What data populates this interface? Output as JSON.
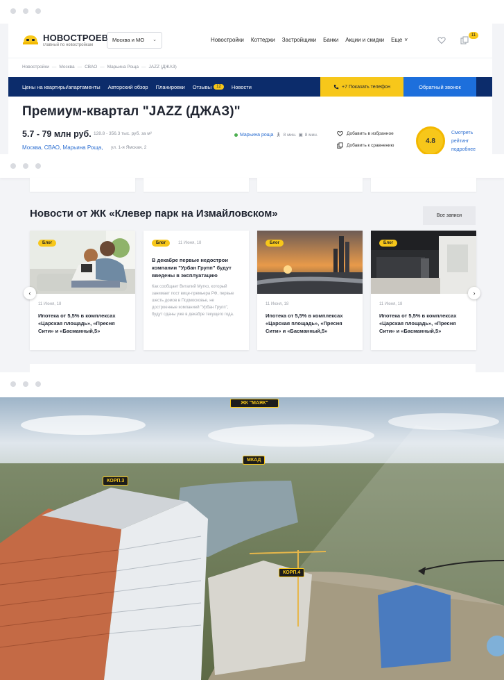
{
  "header": {
    "logo_name": "НОВОСТРОЕВ",
    "logo_tagline": "главный по новостройкам",
    "city": "Москва и МО",
    "nav": [
      "Новостройки",
      "Коттеджи",
      "Застройщики",
      "Банки",
      "Акции и скидки"
    ],
    "nav_more": "Еще",
    "compare_count": "11"
  },
  "breadcrumbs": [
    "Новостройки",
    "Москва",
    "СВАО",
    "Марьина Роща",
    "JAZZ (ДЖАЗ)"
  ],
  "menu": {
    "items": [
      "Цены на квартиры/апартаменты",
      "Авторский обзор",
      "Планировки"
    ],
    "reviews_label": "Отзывы",
    "reviews_count": "12",
    "news_label": "Новости",
    "phone_button": "+7 Показать телефон",
    "callback_button": "Обратный звонок"
  },
  "listing": {
    "title": "Премиум-квартал \"JAZZ (ДЖАЗ)\"",
    "price": "5.7 - 79 млн руб.",
    "price_sqm": "128.8 - 356.3 тыс. руб. за м²",
    "location": "Москва, СВАО, Марьина Роща,",
    "address": "ул. 1-я Ямская, 2",
    "metro": "Марьина роща",
    "metro_walk": "8 мин.",
    "metro_transport": "8 мин.",
    "favorite_label": "Добавить в избранное",
    "compare_label": "Добавить к сравнению",
    "rating": "4.8",
    "rating_link": "Смотреть рейтинг подробнее"
  },
  "news": {
    "title": "Новости от ЖК «Клевер парк на Измайловском»",
    "all_button": "Все записи",
    "badge": "Блог",
    "cards": [
      {
        "date": "11 Июня, 18",
        "headline": "Ипотека от 5,5% в комплексах «Царская площадь», «Пресня Сити» и «Басманный,5»"
      },
      {
        "date": "11 Июня, 18",
        "headline": "В декабре первые недострои компании \"Урбан Групп\" будут введены в эксплуатацию",
        "excerpt": "Как сообщает Виталий Мутко, который занимает пост вице-премьера РФ, первые шесть домов в Подмосковье, не достроенные компанией \"Урбан Групп\", будут сданы уже в декабре текущего года."
      },
      {
        "date": "11 Июня, 18",
        "headline": "Ипотека от 5,5% в комплексах «Царская площадь», «Пресня Сити» и «Басманный,5»"
      },
      {
        "date": "11 Июня, 18",
        "headline": "Ипотека от 5,5% в комплексах «Царская площадь», «Пресня Сити» и «Басманный,5»"
      }
    ]
  },
  "panorama": {
    "pin_top": "ЖК \"МАЯК\"",
    "pin_mkad": "МКАД",
    "pin_k3": "КОРП.3",
    "pin_k4": "КОРП.4"
  },
  "colors": {
    "accent": "#f7c71a",
    "navy": "#0c2c6b",
    "blue": "#1d6fdc",
    "link": "#2d6fd1"
  }
}
